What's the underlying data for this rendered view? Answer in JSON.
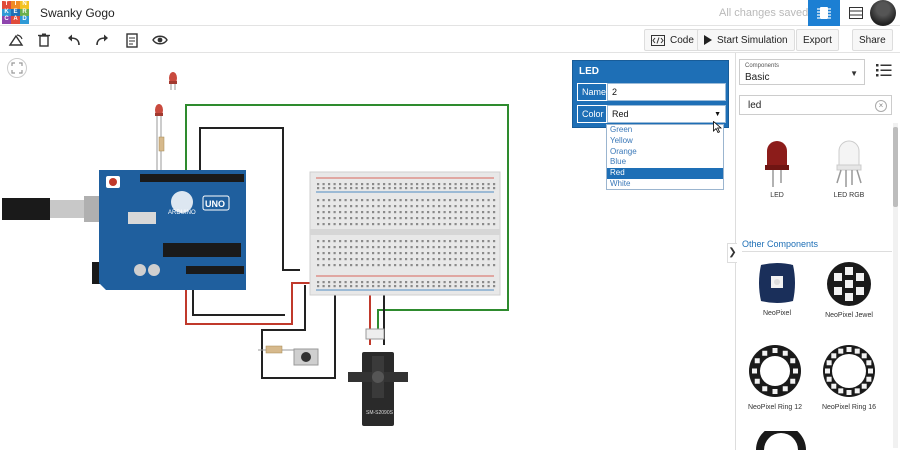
{
  "header": {
    "logo_letters": [
      "T",
      "I",
      "N",
      "K",
      "E",
      "R",
      "C",
      "A",
      "D"
    ],
    "project_title": "Swanky Gogo",
    "save_status": "All changes saved",
    "colors": {
      "accent": "#1c7fd3"
    }
  },
  "toolbar": {
    "code_label": "Code",
    "start_simulation_label": "Start Simulation",
    "export_label": "Export",
    "share_label": "Share"
  },
  "inspector": {
    "title": "LED",
    "name_label": "Name",
    "name_value": "2",
    "color_label": "Color",
    "color_value": "Red",
    "color_options": [
      "Green",
      "Yellow",
      "Orange",
      "Blue",
      "Red",
      "White"
    ],
    "selected_option": "Red"
  },
  "panel": {
    "category_caption": "Components",
    "category_value": "Basic",
    "search_value": "led",
    "results": [
      {
        "label": "LED",
        "icon": "led-icon"
      },
      {
        "label": "LED RGB",
        "icon": "led-rgb-icon"
      }
    ],
    "other_section_title": "Other Components",
    "other": [
      {
        "label": "NeoPixel",
        "icon": "neopixel-icon"
      },
      {
        "label": "NeoPixel Jewel",
        "icon": "neopixel-jewel-icon"
      },
      {
        "label": "NeoPixel Ring 12",
        "icon": "neopixel-ring-12-icon"
      },
      {
        "label": "NeoPixel Ring 16",
        "icon": "neopixel-ring-16-icon"
      }
    ]
  },
  "canvas": {
    "arduino_brand": "UNO",
    "servo_label": "SM-S2090S"
  }
}
